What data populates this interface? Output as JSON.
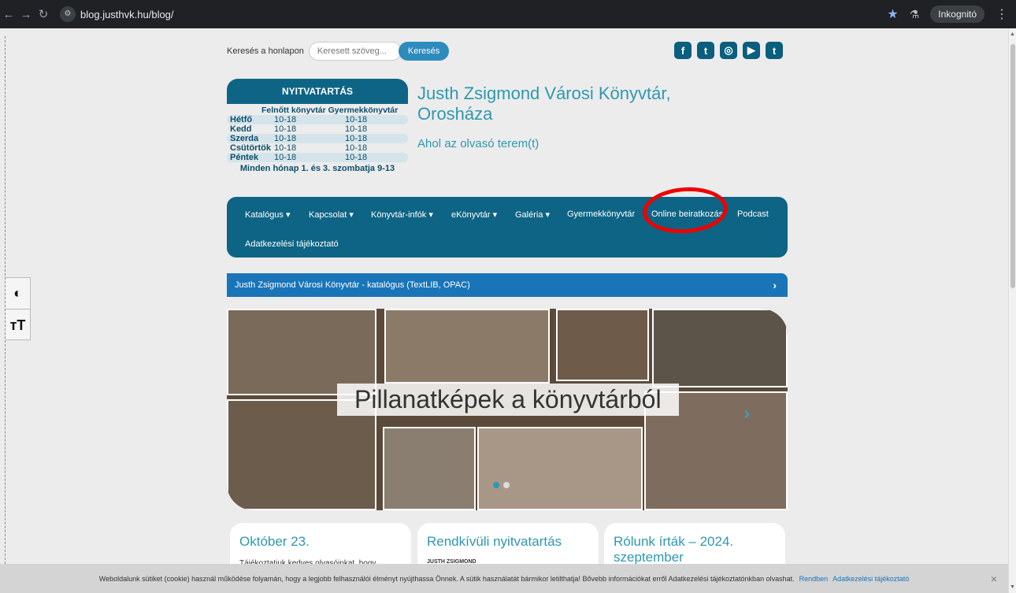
{
  "browser": {
    "url": "blog.justhvk.hu/blog/",
    "incognito_label": "Inkognitó"
  },
  "search": {
    "label": "Keresés a honlapon",
    "placeholder": "Keresett szöveg...",
    "button": "Keresés"
  },
  "hours": {
    "title": "NYITVATARTÁS",
    "col_adult": "Felnőtt könyvtár",
    "col_child": "Gyermekkönyvtár",
    "rows": [
      {
        "day": "Hétfő",
        "adult": "10-18",
        "child": "10-18"
      },
      {
        "day": "Kedd",
        "adult": "10-18",
        "child": "10-18"
      },
      {
        "day": "Szerda",
        "adult": "10-18",
        "child": "10-18"
      },
      {
        "day": "Csütörtök",
        "adult": "10-18",
        "child": "10-18"
      },
      {
        "day": "Péntek",
        "adult": "10-18",
        "child": "10-18"
      }
    ],
    "note": "Minden hónap 1. és 3. szombatja 9-13"
  },
  "brand": {
    "title_line1": "Justh Zsigmond Városi Könyvtár,",
    "title_line2": "Orosháza",
    "tagline": "Ahol az olvasó terem(t)"
  },
  "nav": {
    "items": [
      "Katalógus ▾",
      "Kapcsolat ▾",
      "Könyvtár-infók ▾",
      "eKönyvtár ▾",
      "Galéria ▾",
      "Gyermekkönyvtár",
      "Online beiratkozás",
      "Podcast"
    ],
    "second_row": "Adatkezelési tájékoztató"
  },
  "catalog_bar": {
    "text": "Justh Zsigmond Városi Könyvtár - katalógus (TextLIB, OPAC)",
    "chevron": "›"
  },
  "slider": {
    "caption": "Pillanatképek a könyvtárból",
    "arrow": "›",
    "slide_count": 2,
    "active_slide": 1
  },
  "cards": [
    {
      "title": "Október 23.",
      "text": "Tájékoztatjuk kedves olvasóinkat, hogy"
    },
    {
      "title": "Rendkívüli nyitvatartás",
      "text": "JUSTH ZSIGMOND"
    },
    {
      "title": "Rólunk írták – 2024. szeptember",
      "text": ""
    }
  ],
  "cookie": {
    "text": "Weboldalunk sütiket (cookie) használ működése folyamán, hogy a legjobb felhasználói élményt nyújthassa Önnek. A sütik használatát bármikor letilthatja! Bővebb információkat erről Adatkezelési tájékoztatónkban olvashat.",
    "ok": "Rendben",
    "privacy": "Adatkezelési tájékoztató",
    "close": "×"
  },
  "colors": {
    "primary": "#0e6484",
    "accent": "#2e98b0",
    "catalog": "#1a74b8",
    "highlight": "#ee0000"
  }
}
